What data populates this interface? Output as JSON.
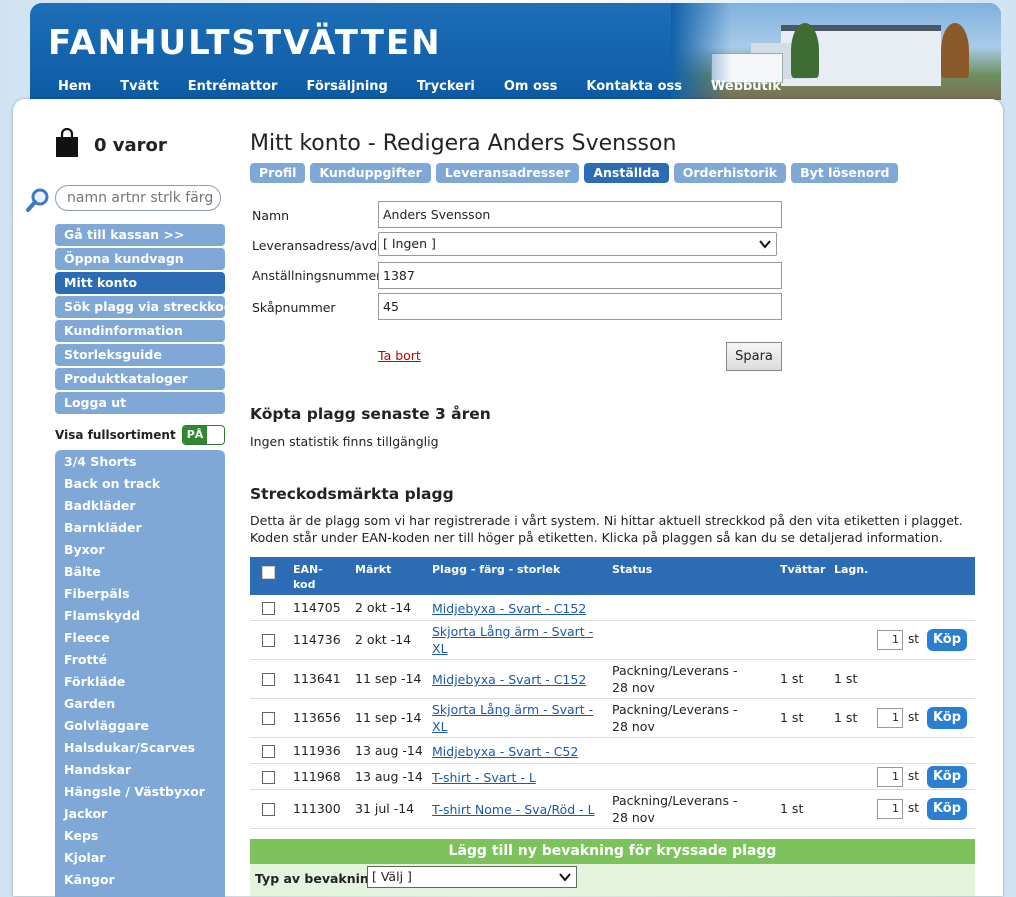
{
  "header": {
    "logo": "Fanhultstvätten",
    "nav": [
      "Hem",
      "Tvätt",
      "Entrémattor",
      "Försäljning",
      "Tryckeri",
      "Om oss",
      "Kontakta oss",
      "Webbutik"
    ]
  },
  "sidebar": {
    "cart_count": "0 varor",
    "search_placeholder": "namn artnr strlk färg",
    "menu": [
      {
        "label": "Gå till kassan >>",
        "active": false
      },
      {
        "label": "Öppna kundvagn",
        "active": false
      },
      {
        "label": "Mitt konto",
        "active": true
      },
      {
        "label": "Sök plagg via streckkod",
        "active": false
      },
      {
        "label": "Kundinformation",
        "active": false
      },
      {
        "label": "Storleksguide",
        "active": false
      },
      {
        "label": "Produktkataloger",
        "active": false
      },
      {
        "label": "Logga ut",
        "active": false
      }
    ],
    "toggle_label": "Visa fullsortiment",
    "toggle_state": "PÅ",
    "categories": [
      "3/4 Shorts",
      "Back on track",
      "Badkläder",
      "Barnkläder",
      "Byxor",
      "Bälte",
      "Fiberpäls",
      "Flamskydd",
      "Fleece",
      "Frotté",
      "Förkläde",
      "Garden",
      "Golvläggare",
      "Halsdukar/Scarves",
      "Handskar",
      "Hängsle / Västbyxor",
      "Jackor",
      "Keps",
      "Kjolar",
      "Kängor"
    ]
  },
  "main": {
    "title": "Mitt konto - Redigera Anders Svensson",
    "tabs": [
      {
        "label": "Profil",
        "active": false
      },
      {
        "label": "Kunduppgifter",
        "active": false
      },
      {
        "label": "Leveransadresser",
        "active": false
      },
      {
        "label": "Anställda",
        "active": true
      },
      {
        "label": "Orderhistorik",
        "active": false
      },
      {
        "label": "Byt lösenord",
        "active": false
      }
    ],
    "form": {
      "name_label": "Namn",
      "name_value": "Anders Svensson",
      "delivery_label": "Leveransadress/avd",
      "delivery_value": "[ Ingen ]",
      "employee_no_label": "Anställningsnummer",
      "employee_no_value": "1387",
      "locker_label": "Skåpnummer",
      "locker_value": "45",
      "remove_link": "Ta bort",
      "save_button": "Spara"
    },
    "purchased_heading": "Köpta plagg senaste 3 åren",
    "purchased_text": "Ingen statistik finns tillgänglig",
    "barcode_heading": "Streckodsmärkta plagg",
    "barcode_text": "Detta är de plagg som vi har registrerade i vårt system. Ni hittar aktuell streckkod på den vita etiketten i plagget. Koden står under EAN-koden ner till höger på etiketten. Klicka på plaggen så kan du se detaljerad information.",
    "table": {
      "headers": {
        "ean": "EAN-kod",
        "marked": "Märkt",
        "garment": "Plagg - färg - storlek",
        "status": "Status",
        "washes": "Tvättar",
        "repairs": "Lagn."
      },
      "rows": [
        {
          "ean": "114705",
          "marked": "2 okt -14",
          "garment": "Midjebyxa - Svart - C152",
          "status": "",
          "washes": "",
          "repairs": "",
          "qty": "",
          "buy": ""
        },
        {
          "ean": "114736",
          "marked": "2 okt -14",
          "garment": "Skjorta Lång ärm - Svart - XL",
          "status": "",
          "washes": "",
          "repairs": "",
          "qty": "1",
          "buy": "Köp"
        },
        {
          "ean": "113641",
          "marked": "11 sep -14",
          "garment": "Midjebyxa - Svart - C152",
          "status": "Packning/Leverans - 28 nov",
          "washes": "1 st",
          "repairs": "1 st",
          "qty": "",
          "buy": ""
        },
        {
          "ean": "113656",
          "marked": "11 sep -14",
          "garment": "Skjorta Lång ärm - Svart - XL",
          "status": "Packning/Leverans - 28 nov",
          "washes": "1 st",
          "repairs": "1 st",
          "qty": "1",
          "buy": "Köp"
        },
        {
          "ean": "111936",
          "marked": "13 aug -14",
          "garment": "Midjebyxa - Svart - C52",
          "status": "",
          "washes": "",
          "repairs": "",
          "qty": "",
          "buy": ""
        },
        {
          "ean": "111968",
          "marked": "13 aug -14",
          "garment": "T-shirt - Svart - L",
          "status": "",
          "washes": "",
          "repairs": "",
          "qty": "1",
          "buy": "Köp"
        },
        {
          "ean": "111300",
          "marked": "31 jul -14",
          "garment": "T-shirt Nome - Sva/Röd - L",
          "status": "Packning/Leverans - 28 nov",
          "washes": "1 st",
          "repairs": "",
          "qty": "1",
          "buy": "Köp"
        }
      ],
      "unit": "st"
    },
    "watch_bar": "Lägg till ny bevakning för kryssade plagg",
    "watch_label": "Typ av bevakning",
    "watch_select": "[ Välj ]"
  }
}
